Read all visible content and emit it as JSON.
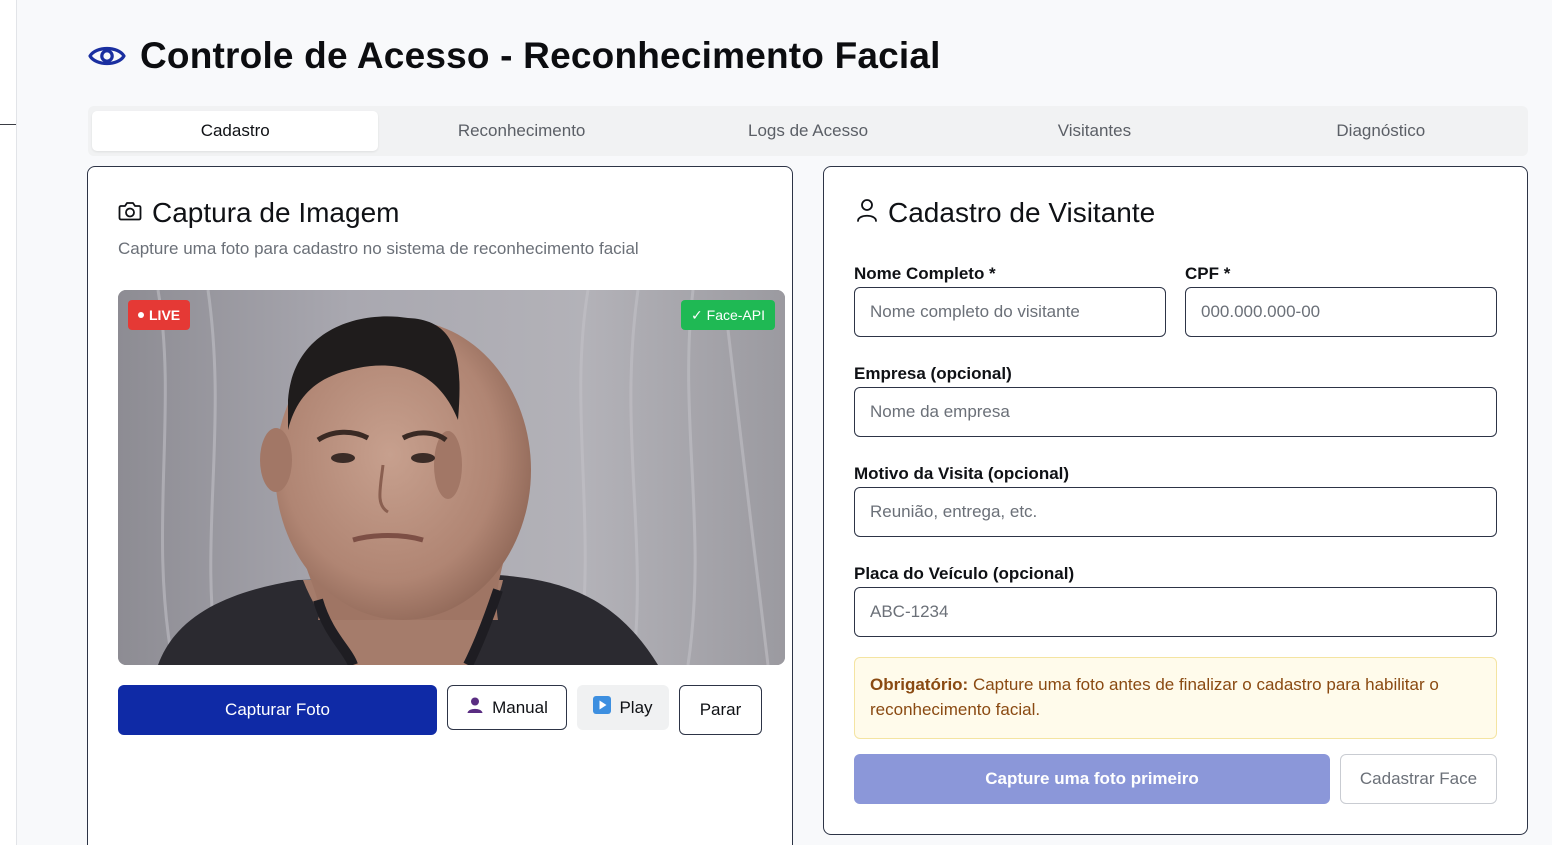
{
  "app": {
    "title": "Controle de Acesso - Reconhecimento Facial",
    "accent_color": "#0f2aa6"
  },
  "tabs": [
    {
      "label": "Cadastro",
      "active": true
    },
    {
      "label": "Reconhecimento",
      "active": false
    },
    {
      "label": "Logs de Acesso",
      "active": false
    },
    {
      "label": "Visitantes",
      "active": false
    },
    {
      "label": "Diagnóstico",
      "active": false
    }
  ],
  "capture": {
    "title": "Captura de Imagem",
    "subtitle": "Capture uma foto para cadastro no sistema de reconhecimento facial",
    "live_badge": "LIVE",
    "face_api_badge": "✓ Face-API",
    "buttons": {
      "capture": "Capturar Foto",
      "manual": "Manual",
      "play": "Play",
      "stop": "Parar"
    }
  },
  "form": {
    "title": "Cadastro de Visitante",
    "fields": {
      "name": {
        "label": "Nome Completo *",
        "placeholder": "Nome completo do visitante",
        "value": ""
      },
      "cpf": {
        "label": "CPF *",
        "placeholder": "000.000.000-00",
        "value": ""
      },
      "company": {
        "label": "Empresa (opcional)",
        "placeholder": "Nome da empresa",
        "value": ""
      },
      "reason": {
        "label": "Motivo da Visita (opcional)",
        "placeholder": "Reunião, entrega, etc.",
        "value": ""
      },
      "plate": {
        "label": "Placa do Veículo (opcional)",
        "placeholder": "ABC-1234",
        "value": ""
      }
    },
    "notice": {
      "strong": "Obrigatório:",
      "text": " Capture uma foto antes de finalizar o cadastro para habilitar o reconhecimento facial."
    },
    "buttons": {
      "submit": "Capture uma foto primeiro",
      "register_face": "Cadastrar Face"
    }
  }
}
